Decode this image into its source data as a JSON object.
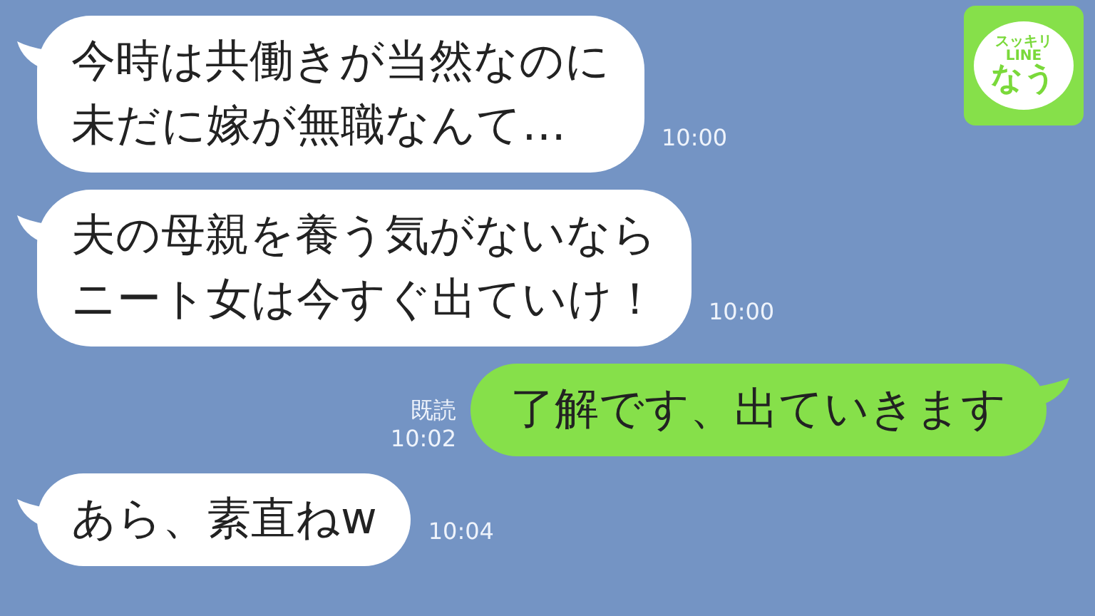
{
  "messages": [
    {
      "kind": "incoming",
      "lines": [
        "今時は共働きが当然なのに",
        "未だに嫁が無職なんて…"
      ],
      "time": "10:00"
    },
    {
      "kind": "incoming",
      "lines": [
        "夫の母親を養う気がないなら",
        "ニート女は今すぐ出ていけ！"
      ],
      "time": "10:00"
    },
    {
      "kind": "outgoing",
      "lines": [
        "了解です、出ていきます"
      ],
      "read": "既読",
      "time": "10:02"
    },
    {
      "kind": "incoming",
      "lines": [
        "あら、素直ねw"
      ],
      "time": "10:04"
    }
  ],
  "logo": {
    "top": "スッキリ",
    "middle": "LINE",
    "bottom": "なう"
  }
}
